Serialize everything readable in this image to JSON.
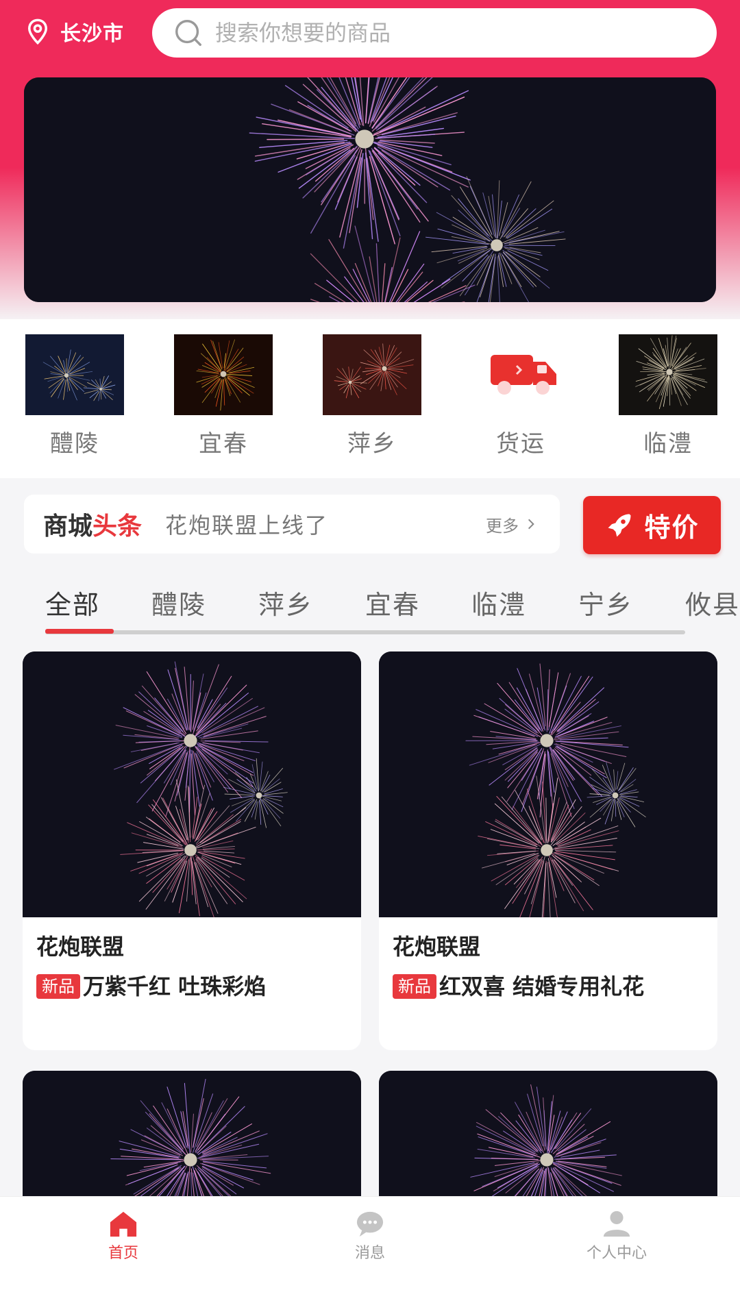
{
  "header": {
    "city": "长沙市",
    "search_placeholder": "搜索你想要的商品"
  },
  "categories": [
    {
      "label": "醴陵",
      "icon": "fireworks-thumb-blue"
    },
    {
      "label": "宜春",
      "icon": "fireworks-thumb-orange"
    },
    {
      "label": "萍乡",
      "icon": "fireworks-thumb-red"
    },
    {
      "label": "货运",
      "icon": "truck-icon"
    },
    {
      "label": "临澧",
      "icon": "fireworks-thumb-gold"
    }
  ],
  "news": {
    "title_part1": "商城",
    "title_part2": "头条",
    "headline": "花炮联盟上线了",
    "more_label": "更多"
  },
  "deal_button": {
    "label": "特价",
    "icon": "rocket-icon"
  },
  "tabs": [
    {
      "label": "全部"
    },
    {
      "label": "醴陵"
    },
    {
      "label": "萍乡"
    },
    {
      "label": "宜春"
    },
    {
      "label": "临澧"
    },
    {
      "label": "宁乡"
    },
    {
      "label": "攸县"
    }
  ],
  "products": [
    {
      "shop": "花炮联盟",
      "badge": "新品",
      "name": "万紫千红 吐珠彩焰"
    },
    {
      "shop": "花炮联盟",
      "badge": "新品",
      "name": "红双喜 结婚专用礼花"
    },
    {
      "shop": "",
      "badge": "",
      "name": ""
    },
    {
      "shop": "",
      "badge": "",
      "name": ""
    }
  ],
  "bottom_nav": [
    {
      "label": "首页",
      "icon": "home-icon"
    },
    {
      "label": "消息",
      "icon": "message-icon"
    },
    {
      "label": "个人中心",
      "icon": "user-icon"
    }
  ],
  "colors": {
    "brand": "#ef2a5a",
    "accent": "#e8383d",
    "deal": "#e82825"
  }
}
